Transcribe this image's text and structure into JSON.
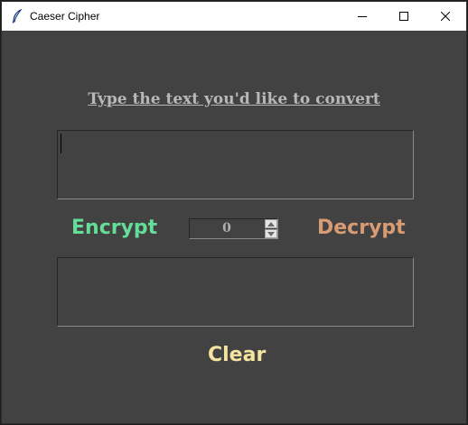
{
  "window": {
    "title": "Caeser Cipher",
    "icon": "feather-icon"
  },
  "controls": {
    "minimize_icon": "minimize-icon",
    "maximize_icon": "maximize-icon",
    "close_icon": "close-icon"
  },
  "main": {
    "prompt": "Type the text you'd like to convert",
    "input_text": "",
    "output_text": "",
    "encrypt_label": "Encrypt",
    "decrypt_label": "Decrypt",
    "clear_label": "Clear",
    "shift": {
      "value": "0",
      "up_icon": "spin-up-arrow-icon",
      "down_icon": "spin-down-arrow-icon"
    }
  },
  "colors": {
    "background": "#424242",
    "prompt": "#b8b8b8",
    "encrypt": "#63dd97",
    "decrypt": "#d89b74",
    "clear": "#f5e3a0"
  }
}
